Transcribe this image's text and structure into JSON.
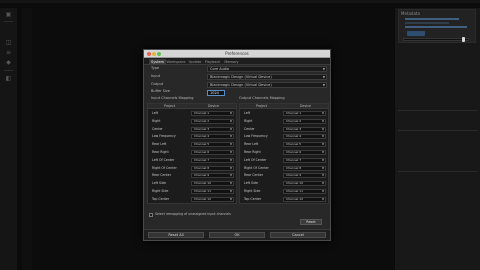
{
  "window": {
    "title": "Preferences"
  },
  "tabs": [
    {
      "label": "System",
      "active": true
    },
    {
      "label": "Workspace",
      "active": false
    },
    {
      "label": "Update",
      "active": false
    },
    {
      "label": "Playback",
      "active": false
    },
    {
      "label": "Memory",
      "active": false
    }
  ],
  "audio_settings": {
    "type_label": "Type",
    "type_value": "Core Audio",
    "input_label": "Input",
    "input_value": "Blackmagic Design (Virtual Device)",
    "output_label": "Output",
    "output_value": "Blackmagic Design (Virtual Device)",
    "buffer_label": "Buffer Size",
    "buffer_value": "1024"
  },
  "input_mapping": {
    "title": "Input Channels Mapping",
    "project_header": "Project",
    "device_header": "Device",
    "rows": [
      {
        "project": "Left",
        "device": "Channel 1"
      },
      {
        "project": "Right",
        "device": "Channel 2"
      },
      {
        "project": "Center",
        "device": "Channel 3"
      },
      {
        "project": "Low Frequency",
        "device": "Channel 4"
      },
      {
        "project": "Rear Left",
        "device": "Channel 5"
      },
      {
        "project": "Rear Right",
        "device": "Channel 6"
      },
      {
        "project": "Left Of Center",
        "device": "Channel 7"
      },
      {
        "project": "Right Of Center",
        "device": "Channel 8"
      },
      {
        "project": "Rear Center",
        "device": "Channel 9"
      },
      {
        "project": "Left Side",
        "device": "Channel 10"
      },
      {
        "project": "Right Side",
        "device": "Channel 11"
      },
      {
        "project": "Top Center",
        "device": "Channel 12"
      }
    ]
  },
  "output_mapping": {
    "title": "Output Channels Mapping",
    "project_header": "Project",
    "device_header": "Device",
    "rows": [
      {
        "project": "Left",
        "device": "Channel 1"
      },
      {
        "project": "Right",
        "device": "Channel 2"
      },
      {
        "project": "Center",
        "device": "Channel 3"
      },
      {
        "project": "Low Frequency",
        "device": "Channel 4"
      },
      {
        "project": "Rear Left",
        "device": "Channel 5"
      },
      {
        "project": "Rear Right",
        "device": "Channel 6"
      },
      {
        "project": "Left Of Center",
        "device": "Channel 7"
      },
      {
        "project": "Right Of Center",
        "device": "Channel 8"
      },
      {
        "project": "Rear Center",
        "device": "Channel 9"
      },
      {
        "project": "Left Side",
        "device": "Channel 10"
      },
      {
        "project": "Right Side",
        "device": "Channel 11"
      },
      {
        "project": "Top Center",
        "device": "Channel 12"
      }
    ]
  },
  "options": {
    "unassigned_checkbox_label": "Select remapping of unassigned input channels",
    "unassigned_checked": false,
    "reset_label": "Reset"
  },
  "buttons": {
    "reset_all": "Reset All",
    "ok": "OK",
    "cancel": "Cancel"
  },
  "right_panel": {
    "section_title": "Metadata"
  },
  "colors": {
    "accent": "#5b8dc9",
    "dialog_bg": "#282828",
    "app_bg": "#0b0b0b",
    "close": "#ec5f55",
    "minimize": "#e4b33c",
    "maximize": "#5ec44a"
  }
}
